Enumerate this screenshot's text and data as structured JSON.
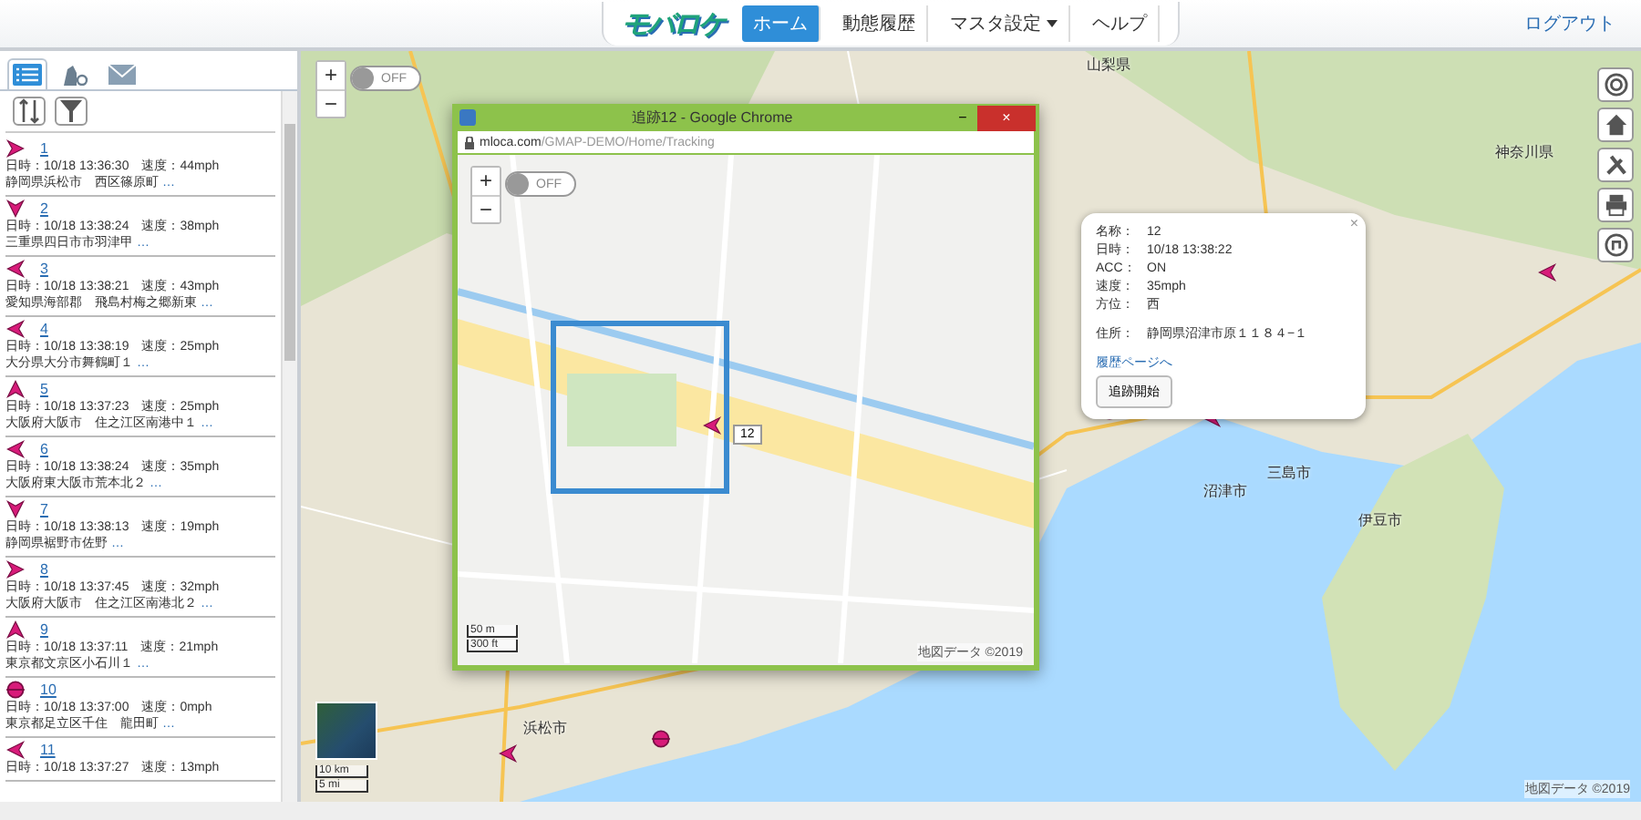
{
  "header": {
    "logo": "モバロケ",
    "nav": [
      {
        "label": "ホーム",
        "selected": true,
        "dropdown": false
      },
      {
        "label": "動態履歴",
        "selected": false,
        "dropdown": false
      },
      {
        "label": "マスタ設定",
        "selected": false,
        "dropdown": true
      },
      {
        "label": "ヘルプ",
        "selected": false,
        "dropdown": false
      }
    ],
    "logout": "ログアウト"
  },
  "sidebar": {
    "tabs": [
      {
        "kind": "list",
        "selected": true
      },
      {
        "kind": "tower",
        "selected": false
      },
      {
        "kind": "mail",
        "selected": false
      }
    ],
    "items": [
      {
        "name": "1",
        "kind": "east",
        "info": "日時：10/18 13:36:30　速度：44mph",
        "address": "静岡県浜松市　西区篠原町",
        "more": "…"
      },
      {
        "name": "2",
        "kind": "south",
        "info": "日時：10/18 13:38:24　速度：38mph",
        "address": "三重県四日市市羽津甲",
        "more": "…"
      },
      {
        "name": "3",
        "kind": "west",
        "info": "日時：10/18 13:38:21　速度：43mph",
        "address": "愛知県海部郡　飛島村梅之郷新東",
        "more": "…"
      },
      {
        "name": "4",
        "kind": "west",
        "info": "日時：10/18 13:38:19　速度：25mph",
        "address": "大分県大分市舞鶴町１",
        "more": "…"
      },
      {
        "name": "5",
        "kind": "north",
        "info": "日時：10/18 13:37:23　速度：25mph",
        "address": "大阪府大阪市　住之江区南港中１",
        "more": "…"
      },
      {
        "name": "6",
        "kind": "west",
        "info": "日時：10/18 13:38:24　速度：35mph",
        "address": "大阪府東大阪市荒本北２",
        "more": "…"
      },
      {
        "name": "7",
        "kind": "south",
        "info": "日時：10/18 13:38:13　速度：19mph",
        "address": "静岡県裾野市佐野",
        "more": "…"
      },
      {
        "name": "8",
        "kind": "east",
        "info": "日時：10/18 13:37:45　速度：32mph",
        "address": "大阪府大阪市　住之江区南港北２",
        "more": "…"
      },
      {
        "name": "9",
        "kind": "north",
        "info": "日時：10/18 13:37:11　速度：21mph",
        "address": "東京都文京区小石川１",
        "more": "…"
      },
      {
        "name": "10",
        "kind": "stopped",
        "info": "日時：10/18 13:37:00　速度：0mph",
        "address": "東京都足立区千住　龍田町",
        "more": "…"
      },
      {
        "name": "11",
        "kind": "west",
        "info": "日時：10/18 13:37:27　速度：13mph"
      }
    ]
  },
  "map": {
    "zoom_in": "+",
    "zoom_out": "−",
    "toggle": {
      "label": "OFF",
      "on": false
    },
    "places": [
      "山梨県",
      "神奈川県",
      "三島市",
      "沼津市",
      "伊豆市",
      "浜松市"
    ],
    "markers": [
      {
        "kind": "stopped"
      },
      {
        "kind": "west"
      },
      {
        "kind": "west"
      },
      {
        "kind": "west"
      },
      {
        "kind": "stopped"
      }
    ],
    "scale": [
      "10 km",
      "5 mi"
    ],
    "copyright": "地図データ ©2019",
    "popup": {
      "fields": [
        {
          "label": "名称：",
          "value": "12"
        },
        {
          "label": "日時：",
          "value": "10/18 13:38:22"
        },
        {
          "label": "ACC：",
          "value": "ON"
        },
        {
          "label": "速度：",
          "value": "35mph"
        },
        {
          "label": "方位：",
          "value": "西"
        },
        {
          "label": "住所：",
          "value": "静岡県沼津市原１１８４−１"
        }
      ],
      "link": "履歴ページへ",
      "button": "追跡開始",
      "close": "×"
    },
    "tools": [
      {
        "kind": "target"
      },
      {
        "kind": "home"
      },
      {
        "kind": "tools"
      },
      {
        "kind": "print"
      },
      {
        "kind": "route"
      }
    ]
  },
  "popup_window": {
    "title": "追跡12 - Google Chrome",
    "url_host": "mloca.com",
    "url_path": "/GMAP-DEMO/Home/Tracking",
    "minimize": "−",
    "close": "×",
    "map": {
      "zoom_in": "+",
      "zoom_out": "−",
      "toggle": {
        "label": "OFF",
        "on": false
      },
      "marker_label": "12",
      "scale": [
        "50 m",
        "300 ft"
      ],
      "copyright": "地図データ ©2019"
    }
  }
}
